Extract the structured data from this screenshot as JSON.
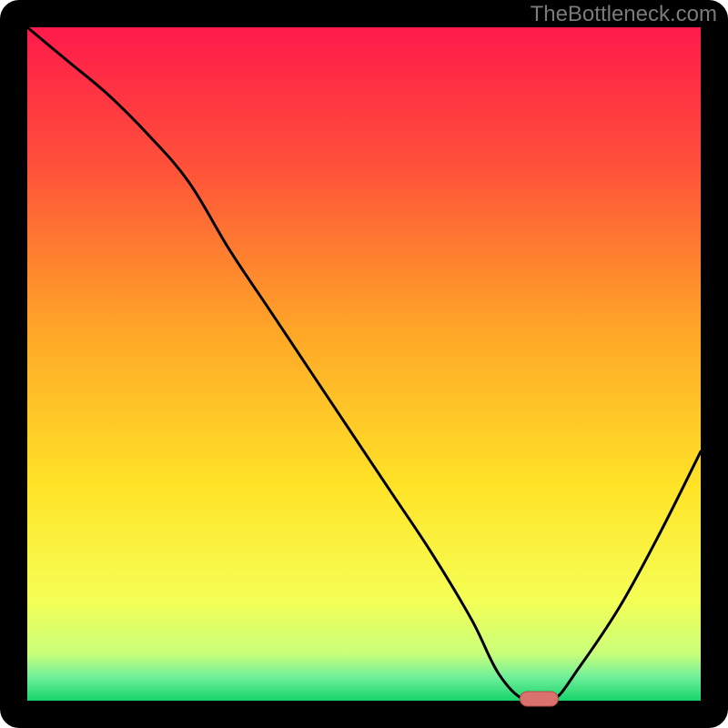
{
  "watermark": "TheBottleneck.com",
  "chart_data": {
    "type": "line",
    "title": "",
    "xlabel": "",
    "ylabel": "",
    "xlim": [
      0,
      100
    ],
    "ylim": [
      0,
      100
    ],
    "grid": false,
    "legend": false,
    "series": [
      {
        "name": "bottleneck-curve",
        "x": [
          0,
          6,
          12,
          18,
          24,
          30,
          36,
          42,
          48,
          54,
          60,
          66,
          70,
          74,
          78,
          82,
          88,
          94,
          100
        ],
        "values": [
          100,
          95,
          90,
          84,
          77,
          67,
          58,
          49,
          40,
          31,
          22,
          12,
          4,
          0,
          0,
          5,
          14,
          25,
          37
        ]
      }
    ],
    "marker": {
      "x": 76,
      "y": 0
    },
    "background_gradient_stops": [
      {
        "offset": 0.0,
        "color": "#ff1a4b"
      },
      {
        "offset": 0.2,
        "color": "#ff4f3a"
      },
      {
        "offset": 0.45,
        "color": "#ffa627"
      },
      {
        "offset": 0.68,
        "color": "#ffe327"
      },
      {
        "offset": 0.85,
        "color": "#f5ff55"
      },
      {
        "offset": 0.93,
        "color": "#c9ff7a"
      },
      {
        "offset": 0.965,
        "color": "#6fef9a"
      },
      {
        "offset": 1.0,
        "color": "#18d46a"
      }
    ],
    "plot_border_color": "#000000",
    "plot_border_width": 30,
    "curve_color": "#000000",
    "curve_width": 3,
    "marker_fill": "#d9726f",
    "marker_stroke": "#b44c48"
  }
}
